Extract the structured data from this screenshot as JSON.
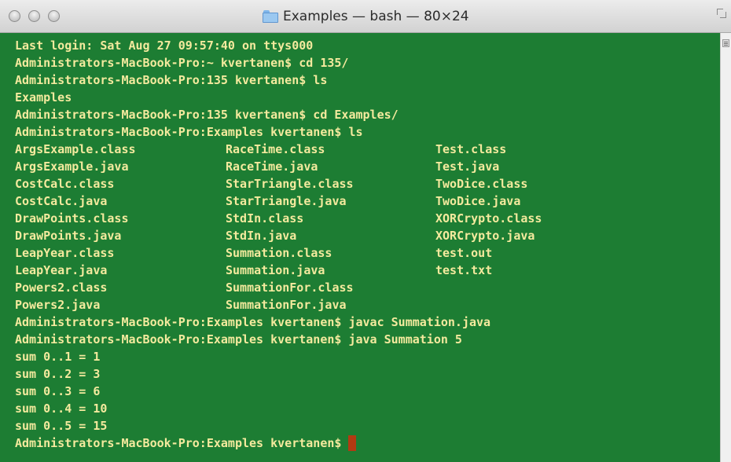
{
  "window": {
    "title": "Examples — bash — 80×24"
  },
  "terminal": {
    "lines": [
      "Last login: Sat Aug 27 09:57:40 on ttys000",
      "Administrators-MacBook-Pro:~ kvertanen$ cd 135/",
      "Administrators-MacBook-Pro:135 kvertanen$ ls",
      "Examples",
      "Administrators-MacBook-Pro:135 kvertanen$ cd Examples/",
      "Administrators-MacBook-Pro:Examples kvertanen$ ls"
    ],
    "listing": [
      [
        "ArgsExample.class",
        "RaceTime.class",
        "Test.class"
      ],
      [
        "ArgsExample.java",
        "RaceTime.java",
        "Test.java"
      ],
      [
        "CostCalc.class",
        "StarTriangle.class",
        "TwoDice.class"
      ],
      [
        "CostCalc.java",
        "StarTriangle.java",
        "TwoDice.java"
      ],
      [
        "DrawPoints.class",
        "StdIn.class",
        "XORCrypto.class"
      ],
      [
        "DrawPoints.java",
        "StdIn.java",
        "XORCrypto.java"
      ],
      [
        "LeapYear.class",
        "Summation.class",
        "test.out"
      ],
      [
        "LeapYear.java",
        "Summation.java",
        "test.txt"
      ],
      [
        "Powers2.class",
        "SummationFor.class",
        ""
      ],
      [
        "Powers2.java",
        "SummationFor.java",
        ""
      ]
    ],
    "after": [
      "Administrators-MacBook-Pro:Examples kvertanen$ javac Summation.java",
      "Administrators-MacBook-Pro:Examples kvertanen$ java Summation 5",
      "sum 0..1 = 1",
      "sum 0..2 = 3",
      "sum 0..3 = 6",
      "sum 0..4 = 10",
      "sum 0..5 = 15"
    ],
    "prompt": "Administrators-MacBook-Pro:Examples kvertanen$ "
  },
  "colors": {
    "background": "#1d7d33",
    "text": "#f4ea9e",
    "cursor": "#b23a12"
  },
  "icons": {
    "close": "close-button-icon",
    "minimize": "minimize-button-icon",
    "zoom": "zoom-button-icon",
    "folder": "folder-icon",
    "fullscreen": "fullscreen-icon",
    "scroll": "scroll-marker-icon"
  }
}
